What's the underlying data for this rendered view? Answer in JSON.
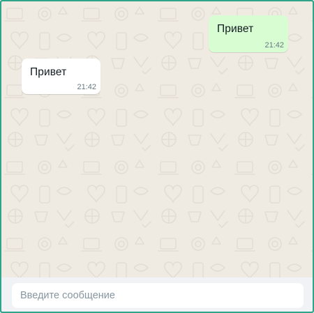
{
  "colors": {
    "frame": "#2fa488",
    "chat_background": "#efeae2",
    "outgoing_bubble": "#d9fdd3",
    "incoming_bubble": "#ffffff",
    "composer_bar": "#f0f2f5"
  },
  "messages": [
    {
      "direction": "outgoing",
      "text": "Привет",
      "time": "21:42"
    },
    {
      "direction": "incoming",
      "text": "Привет",
      "time": "21:42"
    }
  ],
  "composer": {
    "placeholder": "Введите сообщение",
    "value": ""
  }
}
